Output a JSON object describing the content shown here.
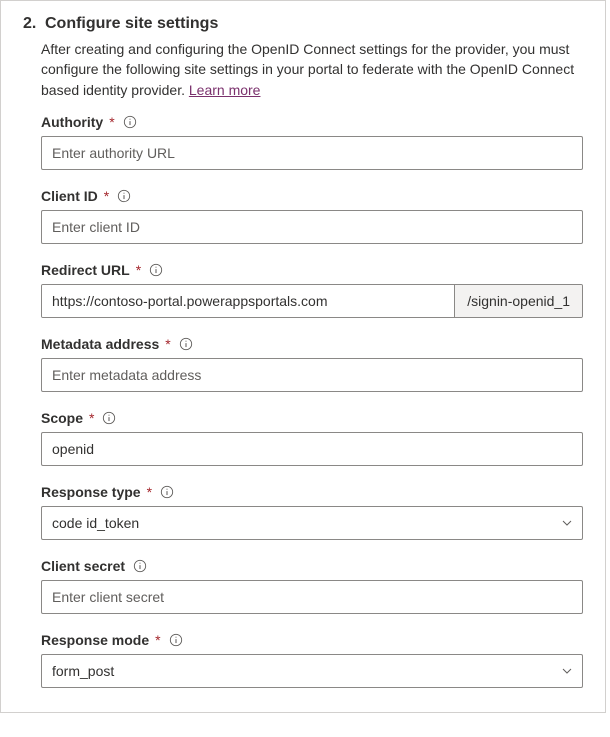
{
  "step": {
    "number": "2.",
    "title": "Configure site settings",
    "description_pre": "After creating and configuring the OpenID Connect settings for the provider, you must configure the following site settings in your portal to federate with the OpenID Connect based identity provider. ",
    "learn_more": "Learn more"
  },
  "required_marker": "*",
  "fields": {
    "authority": {
      "label": "Authority",
      "required": true,
      "placeholder": "Enter authority URL",
      "value": ""
    },
    "client_id": {
      "label": "Client ID",
      "required": true,
      "placeholder": "Enter client ID",
      "value": ""
    },
    "redirect_url": {
      "label": "Redirect URL",
      "required": true,
      "value": "https://contoso-portal.powerappsportals.com",
      "suffix": "/signin-openid_1"
    },
    "metadata_address": {
      "label": "Metadata address",
      "required": true,
      "placeholder": "Enter metadata address",
      "value": ""
    },
    "scope": {
      "label": "Scope",
      "required": true,
      "value": "openid"
    },
    "response_type": {
      "label": "Response type",
      "required": true,
      "value": "code id_token"
    },
    "client_secret": {
      "label": "Client secret",
      "required": false,
      "placeholder": "Enter client secret",
      "value": ""
    },
    "response_mode": {
      "label": "Response mode",
      "required": true,
      "value": "form_post"
    }
  }
}
